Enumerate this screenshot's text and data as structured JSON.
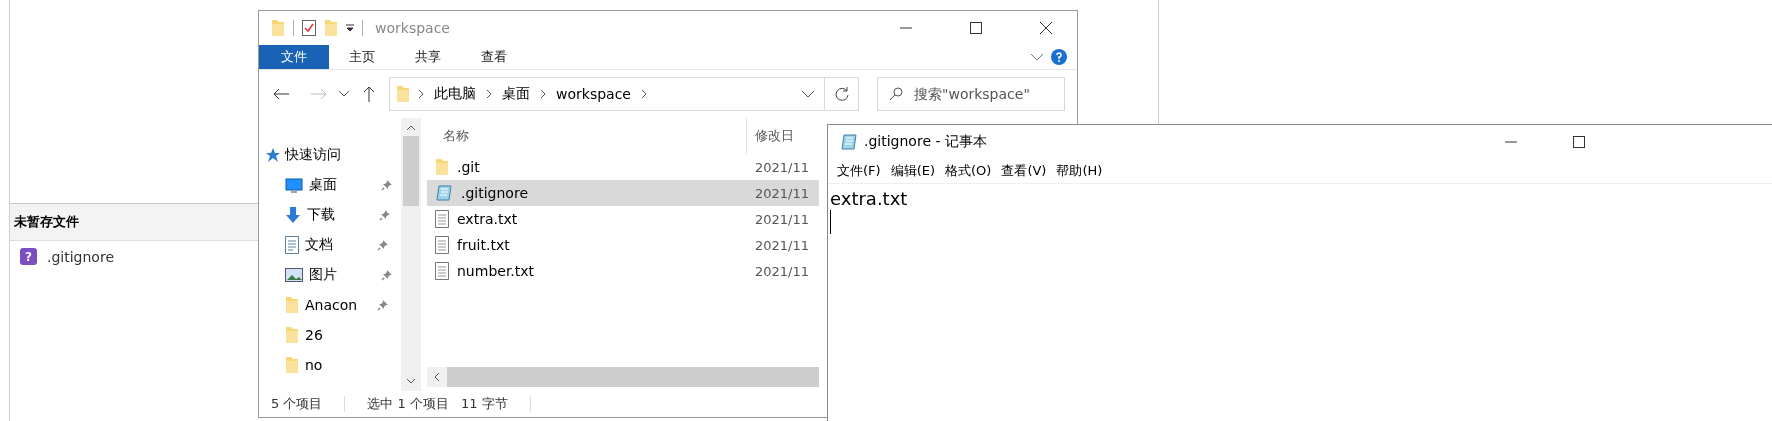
{
  "unstaged_panel": {
    "title": "未暂存文件",
    "files": [
      {
        "badge": "?",
        "name": ".gitignore"
      }
    ]
  },
  "explorer": {
    "title": "workspace",
    "ribbon_tabs": [
      {
        "label": "文件",
        "selected": true
      },
      {
        "label": "主页",
        "selected": false
      },
      {
        "label": "共享",
        "selected": false
      },
      {
        "label": "查看",
        "selected": false
      }
    ],
    "address": [
      "此电脑",
      "桌面",
      "workspace"
    ],
    "search": {
      "placeholder": "搜索\"workspace\""
    },
    "nav_items": [
      {
        "label": "快速访问",
        "kind": "star",
        "pinned": false
      },
      {
        "label": "桌面",
        "kind": "desktop",
        "pinned": true
      },
      {
        "label": "下载",
        "kind": "download",
        "pinned": true
      },
      {
        "label": "文档",
        "kind": "document",
        "pinned": true
      },
      {
        "label": "图片",
        "kind": "pictures",
        "pinned": true
      },
      {
        "label": "Anacon",
        "kind": "folder",
        "pinned": true
      },
      {
        "label": "26",
        "kind": "folder",
        "pinned": false
      },
      {
        "label": "no",
        "kind": "folder",
        "pinned": false
      }
    ],
    "columns": [
      "名称",
      "修改日"
    ],
    "files": [
      {
        "name": ".git",
        "kind": "folder",
        "date": "2021/11",
        "selected": false
      },
      {
        "name": ".gitignore",
        "kind": "notepad",
        "date": "2021/11",
        "selected": true
      },
      {
        "name": "extra.txt",
        "kind": "text",
        "date": "2021/11",
        "selected": false
      },
      {
        "name": "fruit.txt",
        "kind": "text",
        "date": "2021/11",
        "selected": false
      },
      {
        "name": "number.txt",
        "kind": "text",
        "date": "2021/11",
        "selected": false
      }
    ],
    "status": [
      "5 个项目",
      "选中 1 个项目",
      "11 字节"
    ]
  },
  "notepad": {
    "title": ".gitignore - 记事本",
    "menu": [
      "文件(F)",
      "编辑(E)",
      "格式(O)",
      "查看(V)",
      "帮助(H)"
    ],
    "content": "extra.txt"
  }
}
